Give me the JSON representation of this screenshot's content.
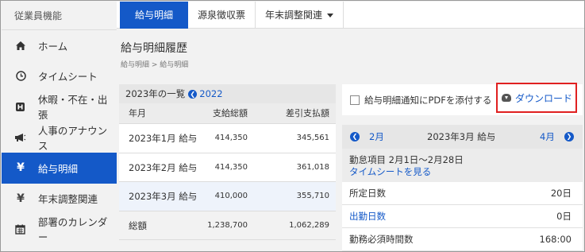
{
  "sidebar": {
    "header": "従業員機能",
    "items": [
      {
        "label": "ホーム",
        "icon": "home-icon",
        "glyph": "⌂"
      },
      {
        "label": "タイムシート",
        "icon": "clock-icon",
        "glyph": "⊙"
      },
      {
        "label": "休暇・不在・出張",
        "icon": "leave-icon",
        "glyph": "▣"
      },
      {
        "label": "人事のアナウンス",
        "icon": "megaphone-icon",
        "glyph": "◀"
      },
      {
        "label": "給与明細",
        "icon": "yen-icon",
        "glyph": "¥"
      },
      {
        "label": "年末調整関連",
        "icon": "yen-icon",
        "glyph": "¥"
      },
      {
        "label": "部署のカレンダー",
        "icon": "calendar-icon",
        "glyph": "▦"
      }
    ]
  },
  "tabs": [
    {
      "label": "給与明細"
    },
    {
      "label": "源泉徴収票"
    },
    {
      "label": "年末調整関連"
    }
  ],
  "main": {
    "title": "給与明細履歴",
    "breadcrumb": "給与明細 > 給与明細"
  },
  "history": {
    "list_label": "2023年の一覧",
    "prev_year": "2022",
    "columns": [
      "年月",
      "支給総額",
      "差引支払額"
    ],
    "rows": [
      {
        "month": "2023年1月 給与",
        "gross": "414,350",
        "net": "345,561"
      },
      {
        "month": "2023年2月 給与",
        "gross": "414,350",
        "net": "361,018"
      },
      {
        "month": "2023年3月 給与",
        "gross": "410,000",
        "net": "355,710"
      }
    ],
    "total": {
      "label": "総額",
      "gross": "1,238,700",
      "net": "1,062,289"
    }
  },
  "detail": {
    "attach_label": "給与明細通知にPDFを添付する",
    "download_label": "ダウンロード",
    "prev_month": "2月",
    "current": "2023年3月 給与",
    "next_month": "4月",
    "attendance_title": "勤怠項目  2月1日～2月28日",
    "timesheet_link": "タイムシートを見る",
    "stats": [
      {
        "label": "所定日数",
        "value": "20日"
      },
      {
        "label": "出勤日数",
        "value": "0日"
      },
      {
        "label": "勤務必須時間数",
        "value": "168:00"
      }
    ]
  },
  "colors": {
    "accent": "#1459c8",
    "highlight_border": "#e02020"
  }
}
